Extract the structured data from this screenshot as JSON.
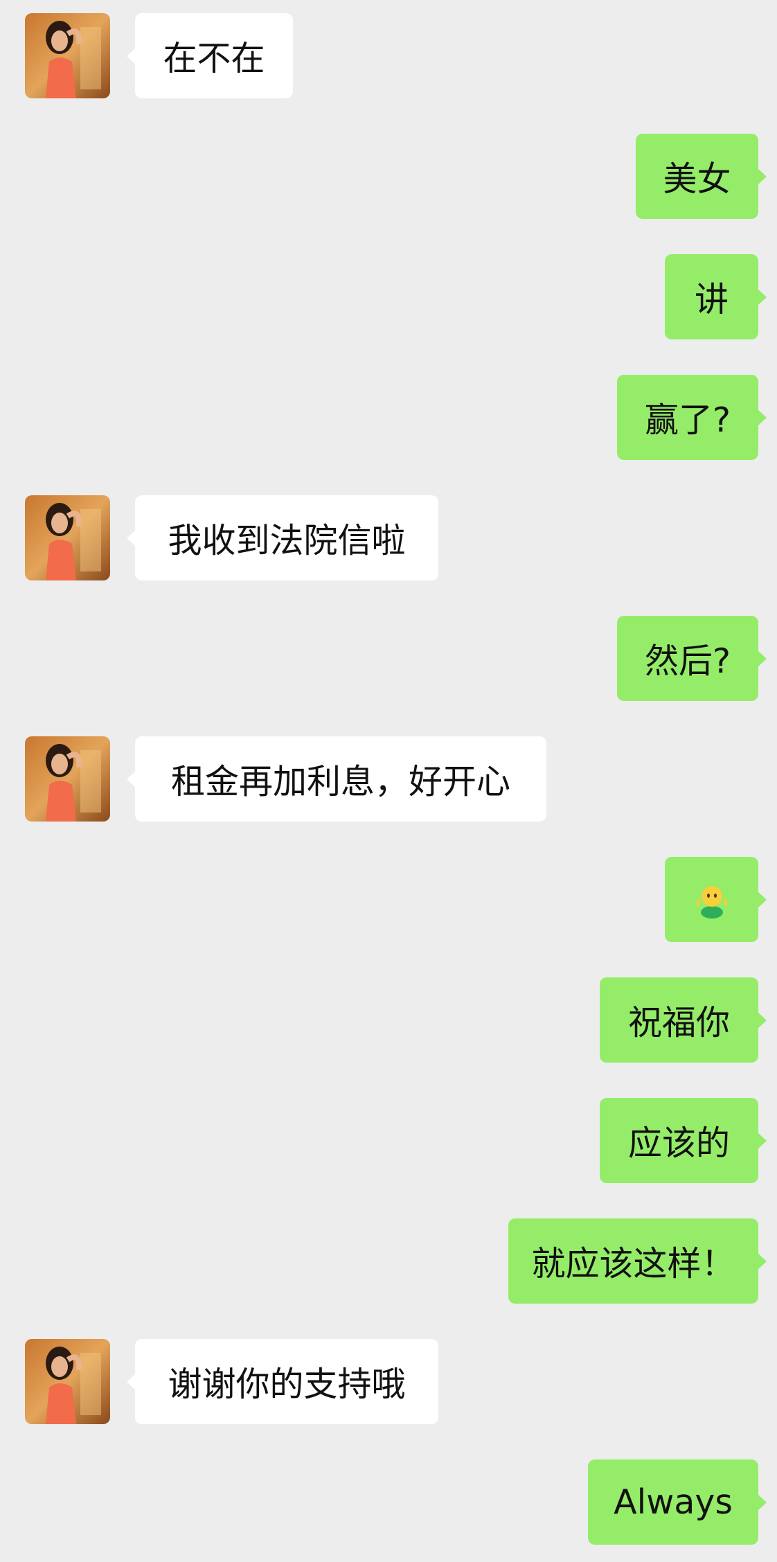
{
  "theme": {
    "background": "#ededed",
    "incoming_bubble": "#ffffff",
    "outgoing_bubble": "#95ec69",
    "text": "#111111"
  },
  "messages": [
    {
      "side": "in",
      "text": "在不在",
      "avatar": "woman-avatar"
    },
    {
      "side": "out",
      "text": "美女"
    },
    {
      "side": "out",
      "text": "讲"
    },
    {
      "side": "out",
      "text": "赢了?"
    },
    {
      "side": "in",
      "text": "我收到法院信啦",
      "avatar": "woman-avatar"
    },
    {
      "side": "out",
      "text": "然后?"
    },
    {
      "side": "in",
      "text": "租金再加利息，好开心",
      "avatar": "woman-avatar"
    },
    {
      "side": "out",
      "text": "",
      "icon": "shrug-emoji-icon"
    },
    {
      "side": "out",
      "text": "祝福你"
    },
    {
      "side": "out",
      "text": "应该的"
    },
    {
      "side": "out",
      "text": "就应该这样！"
    },
    {
      "side": "in",
      "text": "谢谢你的支持哦",
      "avatar": "woman-avatar"
    },
    {
      "side": "out",
      "text": "Always"
    }
  ]
}
